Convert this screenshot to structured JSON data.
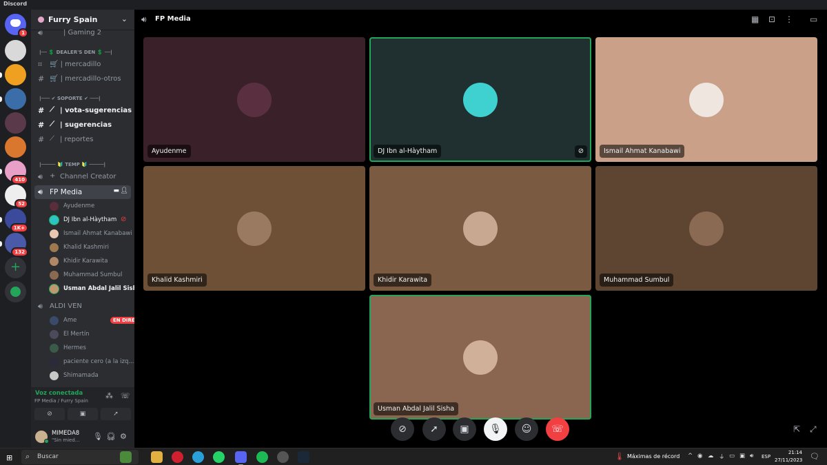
{
  "window": {
    "title": "Discord"
  },
  "servers": [
    {
      "name": "home",
      "badge": "1",
      "color": "#5865f2"
    },
    {
      "name": "server-2",
      "badge": "",
      "color": "#d9d9d9"
    },
    {
      "name": "server-3",
      "badge": "",
      "color": "#f0a020"
    },
    {
      "name": "server-4",
      "badge": "",
      "color": "#3b6ea8"
    },
    {
      "name": "server-5",
      "badge": "",
      "color": "#5a3a4a"
    },
    {
      "name": "server-6",
      "badge": "",
      "color": "#d9772e"
    },
    {
      "name": "server-7",
      "badge": "410",
      "color": "#e8a0c8"
    },
    {
      "name": "server-8",
      "badge": "52",
      "color": "#eeeeee"
    },
    {
      "name": "server-9",
      "badge": "1K+",
      "color": "#3c4a9c"
    },
    {
      "name": "server-10",
      "badge": "132",
      "color": "#4a5aa8"
    }
  ],
  "guild": {
    "name": "Furry Spain"
  },
  "channels": {
    "gaming2": "| Gaming 2",
    "cat_dealers": "|── 💲 DEALER'S DEN 💲 ──|",
    "mercadillo": "🛒 | mercadillo",
    "mercadillo_otros": "🛒 | mercadillo-otros",
    "cat_soporte": "|─── ✔ SOPORTE ✔ ───|",
    "vota": "| vota-sugerencias",
    "sugerencias": "| sugerencias",
    "reportes": "| reportes",
    "cat_temp": "|───── 🔰 TEMP 🔰 ─────|",
    "channel_creator": "Channel Creator",
    "fp_media": "FP Media",
    "aldi_ven": "ALDI VEN"
  },
  "fp_media_members": [
    {
      "name": "Ayudenme",
      "color": "#5a2d3a",
      "on": false
    },
    {
      "name": "DJ Ibn al-Hàytham",
      "color": "#2fc4c4",
      "on": true
    },
    {
      "name": "Ismail Ahmat Kanabawi",
      "color": "#e8c8b0",
      "on": false
    },
    {
      "name": "Khalid Kashmiri",
      "color": "#a07850",
      "on": false
    },
    {
      "name": "Khidir Karawita",
      "color": "#b08868",
      "on": false
    },
    {
      "name": "Muhammad Sumbul",
      "color": "#8a6a50",
      "on": false
    },
    {
      "name": "Usman Abdal Jalil Sisha",
      "color": "#c09870",
      "on": true
    }
  ],
  "aldi_members": [
    {
      "name": "Ame",
      "color": "#3a4a6a",
      "live": "EN DIRECTO"
    },
    {
      "name": "El Mertín",
      "color": "#4a4a5a",
      "live": ""
    },
    {
      "name": "Hermes",
      "color": "#3a5a4a",
      "live": ""
    },
    {
      "name": "paciente cero (a la izq...",
      "color": "#2a2a3a",
      "live": ""
    },
    {
      "name": "Shimamada",
      "color": "#c8c8c8",
      "live": ""
    }
  ],
  "voice_panel": {
    "status": "Voz conectada",
    "location": "FP Media / Furry Spain"
  },
  "user": {
    "name": "MIMEDA8",
    "status": "\"Sin mied..."
  },
  "stage": {
    "title": "FP Media",
    "tiles": [
      {
        "name": "Ayudenme",
        "bg": "#3a2029",
        "avatar": "#5a3040",
        "speaking": false,
        "muted": false
      },
      {
        "name": "DJ Ibn al-Hàytham",
        "bg": "#203030",
        "avatar": "#3fd0d0",
        "speaking": true,
        "muted": true
      },
      {
        "name": "Ismail Ahmat Kanabawi",
        "bg": "#caa088",
        "avatar": "#efe6e0",
        "speaking": false,
        "muted": false
      },
      {
        "name": "Khalid Kashmiri",
        "bg": "#6d5035",
        "avatar": "#9a7a60",
        "speaking": false,
        "muted": false
      },
      {
        "name": "Khidir Karawita",
        "bg": "#7a5a40",
        "avatar": "#c8a890",
        "speaking": false,
        "muted": false
      },
      {
        "name": "Muhammad Sumbul",
        "bg": "#5e4532",
        "avatar": "#8a6a52",
        "speaking": false,
        "muted": false
      },
      {
        "name": "Usman Abdal Jalil Sisha",
        "bg": "#8a6650",
        "avatar": "#d0b098",
        "speaking": true,
        "muted": false
      }
    ]
  },
  "taskbar": {
    "search_placeholder": "Buscar",
    "weather": "Máximas de récord",
    "lang": "ESP",
    "time": "21:14",
    "date": "27/11/2023"
  }
}
